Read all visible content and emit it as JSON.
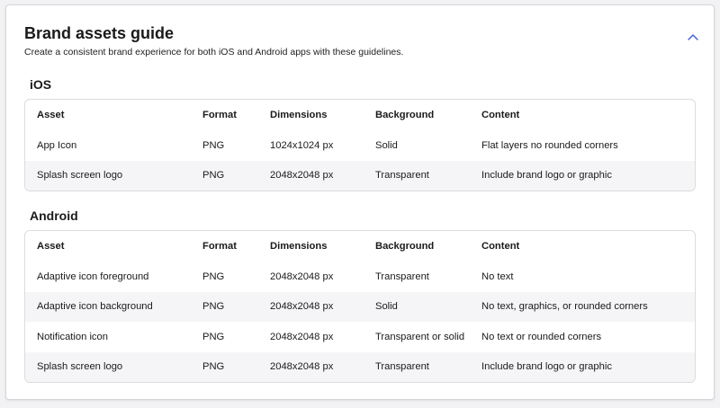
{
  "header": {
    "title": "Brand assets guide",
    "subtitle": "Create a consistent brand experience for both iOS and Android apps with these guidelines."
  },
  "columns": [
    "Asset",
    "Format",
    "Dimensions",
    "Background",
    "Content"
  ],
  "ios": {
    "title": "iOS",
    "rows": [
      [
        "App Icon",
        "PNG",
        "1024x1024 px",
        "Solid",
        "Flat layers no rounded corners"
      ],
      [
        "Splash screen logo",
        "PNG",
        "2048x2048 px",
        "Transparent",
        "Include brand logo or graphic"
      ]
    ]
  },
  "android": {
    "title": "Android",
    "rows": [
      [
        "Adaptive icon foreground",
        "PNG",
        "2048x2048 px",
        "Transparent",
        "No text"
      ],
      [
        "Adaptive icon background",
        "PNG",
        "2048x2048 px",
        "Solid",
        "No text, graphics, or rounded corners"
      ],
      [
        "Notification icon",
        "PNG",
        "2048x2048 px",
        "Transparent or solid",
        "No text or rounded corners"
      ],
      [
        "Splash screen logo",
        "PNG",
        "2048x2048 px",
        "Transparent",
        "Include brand logo or graphic"
      ]
    ]
  },
  "icons": {
    "collapse": "chevron-up-icon"
  },
  "colors": {
    "accent": "#3b5bdb",
    "stripe": "#f5f5f7"
  }
}
